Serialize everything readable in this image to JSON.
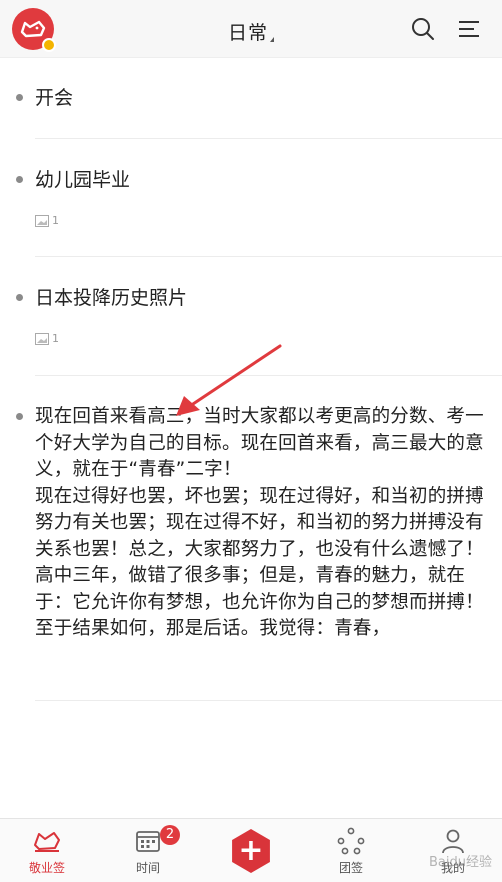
{
  "header": {
    "title": "日常",
    "logo_icon": "pig-logo-icon",
    "search_icon": "search-icon",
    "menu_icon": "menu-icon"
  },
  "notes": [
    {
      "title": "开会"
    },
    {
      "title": "幼儿园毕业",
      "attachment_count": "1"
    },
    {
      "title": "日本投降历史照片",
      "attachment_count": "1"
    },
    {
      "paragraphs": [
        "现在回首来看高三，当时大家都以考更高的分数、考一个好大学为自己的目标。现在回首来看，高三最大的意义，就在于“青春”二字！",
        "现在过得好也罢，坏也罢；现在过得好，和当初的拼搏努力有关也罢；现在过得不好，和当初的努力拼搏没有关系也罢！总之，大家都努力了，也没有什么遗憾了！",
        "高中三年，做错了很多事；但是，青春的魅力，就在于：它允许你有梦想，也允许你为自己的梦想而拼搏！至于结果如何，那是后话。我觉得：青春，"
      ]
    }
  ],
  "bottom_nav": {
    "items": [
      {
        "label": "敬业签",
        "icon": "note-icon",
        "active": true
      },
      {
        "label": "时间",
        "icon": "calendar-icon",
        "badge": "2"
      },
      {
        "label": "+",
        "icon": "add-icon"
      },
      {
        "label": "团签",
        "icon": "team-icon"
      },
      {
        "label": "我的",
        "icon": "user-icon"
      }
    ]
  },
  "watermark": "Baidu经验",
  "colors": {
    "accent": "#d9343a",
    "dot": "#8a8a8a",
    "divider": "#ececec"
  }
}
